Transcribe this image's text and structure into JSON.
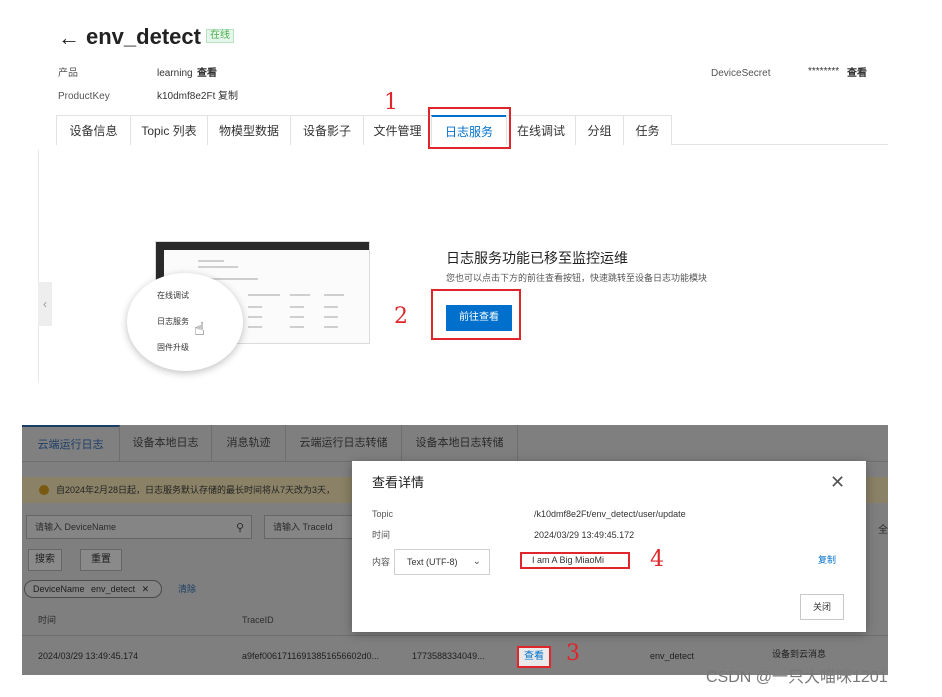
{
  "device": {
    "back_icon": "arrow-left",
    "name": "env_detect",
    "status": "在线"
  },
  "meta": {
    "product_label": "产品",
    "product_value": "learning",
    "product_link": "查看",
    "productkey_label": "ProductKey",
    "productkey_value": "k10dmf8e2Ft",
    "productkey_link": "复制",
    "devicesecret_label": "DeviceSecret",
    "devicesecret_value": "********",
    "devicesecret_link": "查看"
  },
  "tabs": [
    {
      "label": "设备信息"
    },
    {
      "label": "Topic 列表"
    },
    {
      "label": "物模型数据"
    },
    {
      "label": "设备影子"
    },
    {
      "label": "文件管理"
    },
    {
      "label": "日志服务",
      "active": true
    },
    {
      "label": "在线调试"
    },
    {
      "label": "分组"
    },
    {
      "label": "任务"
    }
  ],
  "annotations": {
    "n1": "1",
    "n2": "2",
    "n3": "3",
    "n4": "4"
  },
  "illustration": {
    "menu_items": [
      "在线调试",
      "日志服务",
      "固件升级"
    ],
    "pointer_icon": "hand-pointer-icon"
  },
  "moved": {
    "title": "日志服务功能已移至监控运维",
    "subtitle": "您也可以点击下方的前往查看按钮，快速跳转至设备日志功能模块",
    "button": "前往查看"
  },
  "logs": {
    "tabs": [
      "云端运行日志",
      "设备本地日志",
      "消息轨迹",
      "云端运行日志转储",
      "设备本地日志转储"
    ],
    "notice": "自2024年2月28日起，日志服务默认存储的最长时间将从7天改为3天，",
    "deviceName_placeholder": "请输入 DeviceName",
    "traceId_placeholder": "请输入 TraceId",
    "search_button": "搜索",
    "reset_button": "重置",
    "filter_label": "DeviceName",
    "filter_value": "env_detect",
    "filter_clear": "清除",
    "right_cut": "全",
    "columns": {
      "time": "时间",
      "traceid": "TraceID"
    },
    "row": {
      "time": "2024/03/29 13:49:45.174",
      "traceid": "a9fef00617116913851656602d0...",
      "msgid": "1773588334049...",
      "view": "查看",
      "device": "env_detect",
      "type": "设备到云消息"
    }
  },
  "modal": {
    "title": "查看详情",
    "topic_label": "Topic",
    "topic_value": "/k10dmf8e2Ft/env_detect/user/update",
    "time_label": "时间",
    "time_value": "2024/03/29 13:49:45.172",
    "content_label": "内容",
    "encoding": "Text (UTF-8)",
    "content": "I am A Big MiaoMi",
    "copy": "复制",
    "close_button": "关闭"
  },
  "watermark": "CSDN @一只大喵咪1201"
}
